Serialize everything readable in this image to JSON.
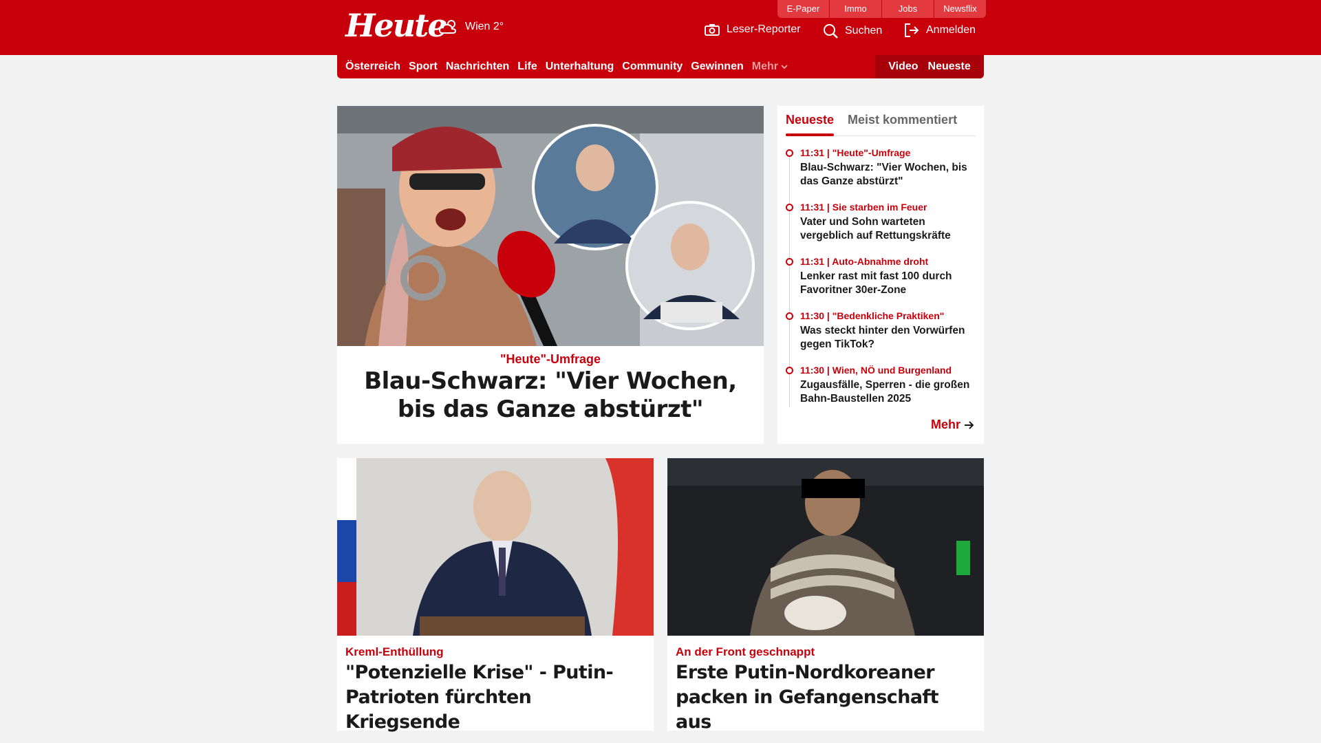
{
  "header": {
    "logo": "Heute",
    "weather": "Wien 2°",
    "service_links": [
      "E-Paper",
      "Immo",
      "Jobs",
      "Newsflix"
    ],
    "actions": {
      "reporter": "Leser-Reporter",
      "search": "Suchen",
      "login": "Anmelden"
    }
  },
  "nav": {
    "items": [
      "Österreich",
      "Sport",
      "Nachrichten",
      "Life",
      "Unterhaltung",
      "Community",
      "Gewinnen"
    ],
    "more": "Mehr",
    "right": [
      "Video",
      "Neueste"
    ]
  },
  "hero": {
    "kicker": "\"Heute\"-Umfrage",
    "title": "Blau-Schwarz: \"Vier Wochen, bis das Ganze abstürzt\""
  },
  "sidebar": {
    "tabs": [
      "Neueste",
      "Meist kommentiert"
    ],
    "items": [
      {
        "kicker": "11:31 | \"Heute\"-Umfrage",
        "title": "Blau-Schwarz: \"Vier Wochen, bis das Ganze abstürzt\""
      },
      {
        "kicker": "11:31 | Sie starben im Feuer",
        "title": "Vater und Sohn warteten vergeblich auf Rettungskräfte"
      },
      {
        "kicker": "11:31 | Auto-Abnahme droht",
        "title": "Lenker rast mit fast 100 durch Favoritner 30er-Zone"
      },
      {
        "kicker": "11:30 | \"Bedenkliche Praktiken\"",
        "title": "Was steckt hinter den Vorwürfen gegen TikTok?"
      },
      {
        "kicker": "11:30 | Wien, NÖ und Burgenland",
        "title": "Zugausfälle, Sperren - die großen Bahn-Baustellen 2025"
      }
    ],
    "more": "Mehr"
  },
  "cards": [
    {
      "kicker": "Kreml-Enthüllung",
      "title": "\"Potenzielle Krise\" - Putin-Patrioten fürchten Kriegsende"
    },
    {
      "kicker": "An der Front geschnappt",
      "title": "Erste Putin-Nordkoreaner packen in Gefangenschaft aus"
    }
  ],
  "colors": {
    "brand_red": "#c8000b",
    "background": "#f2f2f2"
  }
}
